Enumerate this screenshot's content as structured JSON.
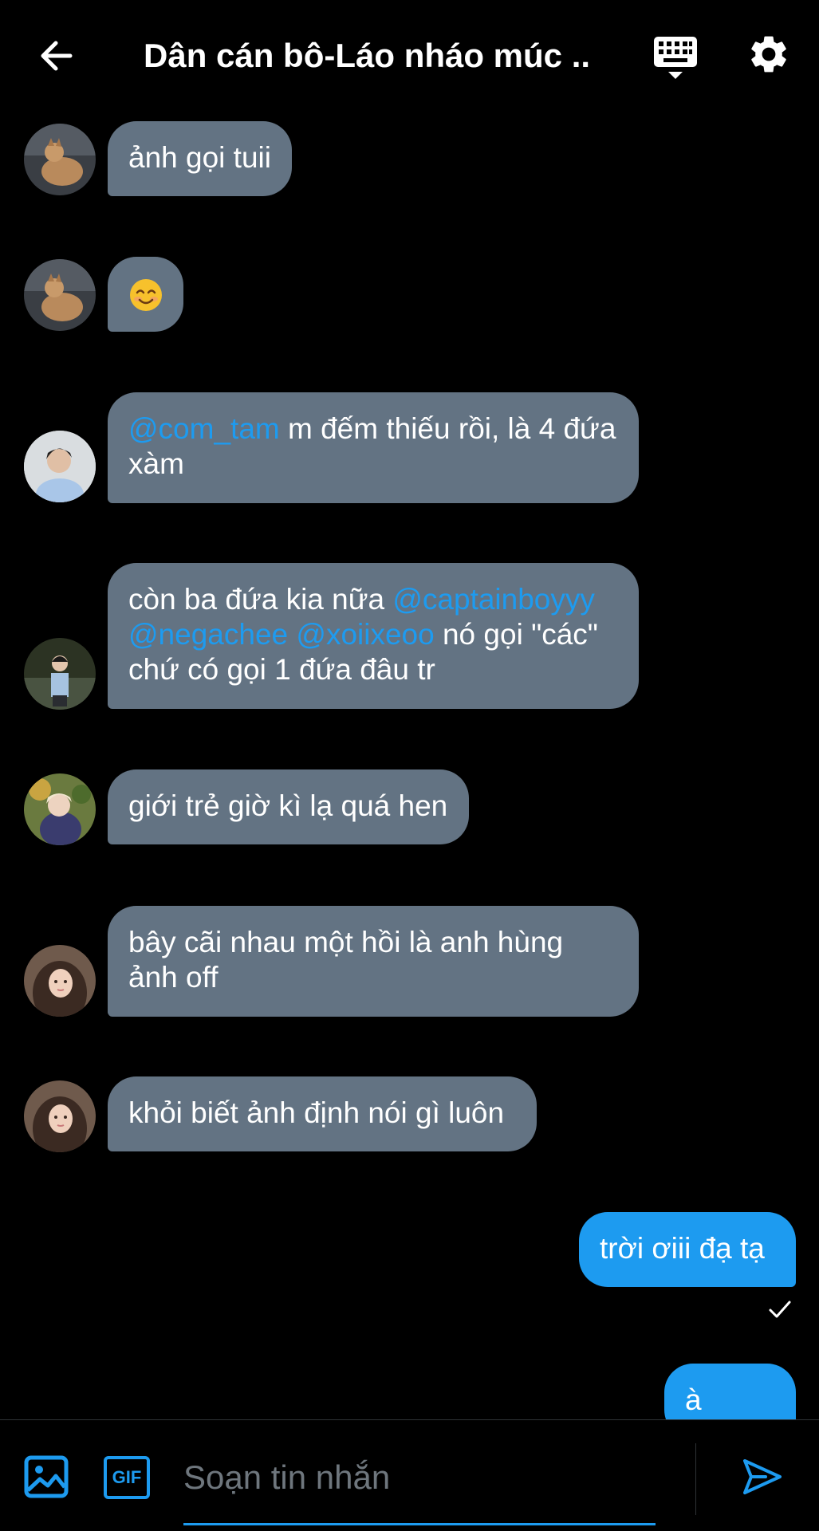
{
  "header": {
    "title": "Dân cán bô-Láo nháo múc ..."
  },
  "messages": {
    "m1": {
      "text": "ảnh gọi tuii"
    },
    "m3": {
      "mention": "@com_tam",
      "text": " m đếm thiếu rồi, là 4 đứa xàm"
    },
    "m4": {
      "t1": "còn ba đứa kia nữa ",
      "mention1": "@captainboyyy",
      "mention2": "@negachee",
      "mention3": "@xoiixeoo",
      "t2": " nó gọi \"các\" chứ có gọi 1 đứa đâu tr"
    },
    "m5": {
      "text": "giới trẻ giờ kì lạ quá hen"
    },
    "m6": {
      "text": "bây cãi nhau một hồi là anh hùng ảnh off"
    },
    "m7": {
      "text": "khỏi biết ảnh định nói gì luôn"
    },
    "m8": {
      "text": "trời ơiii đạ tạ"
    },
    "m9": {
      "text": "à quên"
    }
  },
  "composer": {
    "placeholder": "Soạn tin nhắn",
    "gif_label": "GIF"
  },
  "colors": {
    "accent": "#1d9bf0",
    "bubble_other": "#637383",
    "background": "#000000"
  }
}
